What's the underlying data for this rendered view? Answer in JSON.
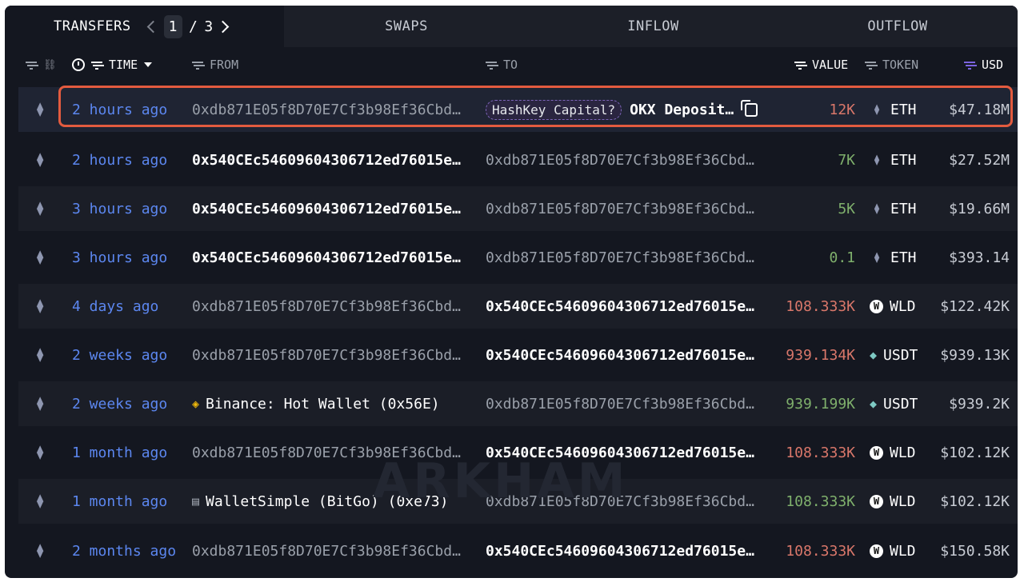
{
  "tabs": {
    "transfers": "TRANSFERS",
    "swaps": "SWAPS",
    "inflow": "INFLOW",
    "outflow": "OUTFLOW",
    "page_current": "1",
    "page_sep": "/",
    "page_total": "3"
  },
  "columns": {
    "time": "TIME",
    "from": "FROM",
    "to": "TO",
    "value": "VALUE",
    "token": "TOKEN",
    "usd": "USD"
  },
  "watermark": "ARKHAM",
  "colors": {
    "time_link": "#5c87f0",
    "negative_value": "#d9776a",
    "positive_value": "#7fb06c",
    "highlight_border": "#e35b3f",
    "usd_icon": "#7b63e0"
  },
  "rows": [
    {
      "time": "2 hours ago",
      "from": "0xdb871E05f8D70E7Cf3b98Ef36Cbd…",
      "to_tag": "HashKey Capital?",
      "to": "OKX Deposit…",
      "value": "12K",
      "token": "ETH",
      "usd": "$47.18M"
    },
    {
      "time": "2 hours ago",
      "from": "0x540CEc54609604306712ed76015e…",
      "to": "0xdb871E05f8D70E7Cf3b98Ef36Cbd…",
      "value": "7K",
      "token": "ETH",
      "usd": "$27.52M"
    },
    {
      "time": "3 hours ago",
      "from": "0x540CEc54609604306712ed76015e…",
      "to": "0xdb871E05f8D70E7Cf3b98Ef36Cbd…",
      "value": "5K",
      "token": "ETH",
      "usd": "$19.66M"
    },
    {
      "time": "3 hours ago",
      "from": "0x540CEc54609604306712ed76015e…",
      "to": "0xdb871E05f8D70E7Cf3b98Ef36Cbd…",
      "value": "0.1",
      "token": "ETH",
      "usd": "$393.14"
    },
    {
      "time": "4 days ago",
      "from": "0xdb871E05f8D70E7Cf3b98Ef36Cbd…",
      "to": "0x540CEc54609604306712ed76015e…",
      "value": "108.333K",
      "token": "WLD",
      "usd": "$122.42K"
    },
    {
      "time": "2 weeks ago",
      "from": "0xdb871E05f8D70E7Cf3b98Ef36Cbd…",
      "to": "0x540CEc54609604306712ed76015e…",
      "value": "939.134K",
      "token": "USDT",
      "usd": "$939.13K"
    },
    {
      "time": "2 weeks ago",
      "from": "Binance: Hot Wallet (0x56E)",
      "to": "0xdb871E05f8D70E7Cf3b98Ef36Cbd…",
      "value": "939.199K",
      "token": "USDT",
      "usd": "$939.2K"
    },
    {
      "time": "1 month ago",
      "from": "0xdb871E05f8D70E7Cf3b98Ef36Cbd…",
      "to": "0x540CEc54609604306712ed76015e…",
      "value": "108.333K",
      "token": "WLD",
      "usd": "$102.12K"
    },
    {
      "time": "1 month ago",
      "from": "WalletSimple (BitGo) (0xe73)",
      "to": "0xdb871E05f8D70E7Cf3b98Ef36Cbd…",
      "value": "108.333K",
      "token": "WLD",
      "usd": "$102.12K"
    },
    {
      "time": "2 months ago",
      "from": "0xdb871E05f8D70E7Cf3b98Ef36Cbd…",
      "to": "0x540CEc54609604306712ed76015e…",
      "value": "108.333K",
      "token": "WLD",
      "usd": "$150.58K"
    }
  ]
}
